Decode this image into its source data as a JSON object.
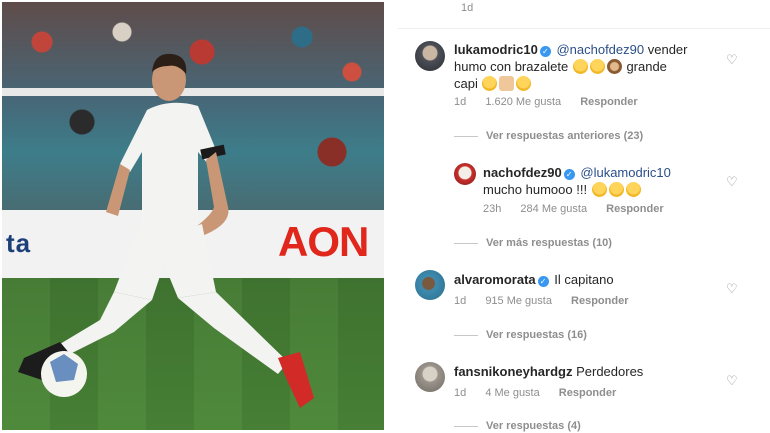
{
  "photo": {
    "banner_left_text": "ta",
    "banner_right_text": "AON"
  },
  "comments": {
    "top_time": "1d",
    "items": [
      {
        "username": "lukamodric10",
        "mention": "@nachofdez90",
        "text_line1": "vender",
        "text_line2": "humo con brazalete",
        "text_line3": "grande",
        "text_line4": "capi",
        "time": "1d",
        "likes": "1.620 Me gusta",
        "reply": "Responder",
        "avatar_icon": "profile-photo"
      },
      {
        "username": "nachofdez90",
        "mention": "@lukamodric10",
        "text_line2": "mucho humooo !!!",
        "time": "23h",
        "likes": "284 Me gusta",
        "reply": "Responder",
        "avatar_icon": "profile-photo"
      },
      {
        "username": "alvaromorata",
        "text": "Il capitano",
        "time": "1d",
        "likes": "915 Me gusta",
        "reply": "Responder",
        "avatar_icon": "profile-photo"
      },
      {
        "username": "fansnikoneyhardgz",
        "text": "Perdedores",
        "time": "1d",
        "likes": "4 Me gusta",
        "reply": "Responder",
        "avatar_icon": "profile-photo"
      }
    ],
    "threads": {
      "previous_replies": "Ver respuestas anteriores (23)",
      "more_replies": "Ver más respuestas (10)",
      "replies_16": "Ver respuestas (16)",
      "replies_4": "Ver respuestas (4)"
    },
    "colors": {
      "mention": "#2b4f8a",
      "verified": "#3897f0",
      "meta": "#8e8e8e"
    }
  }
}
